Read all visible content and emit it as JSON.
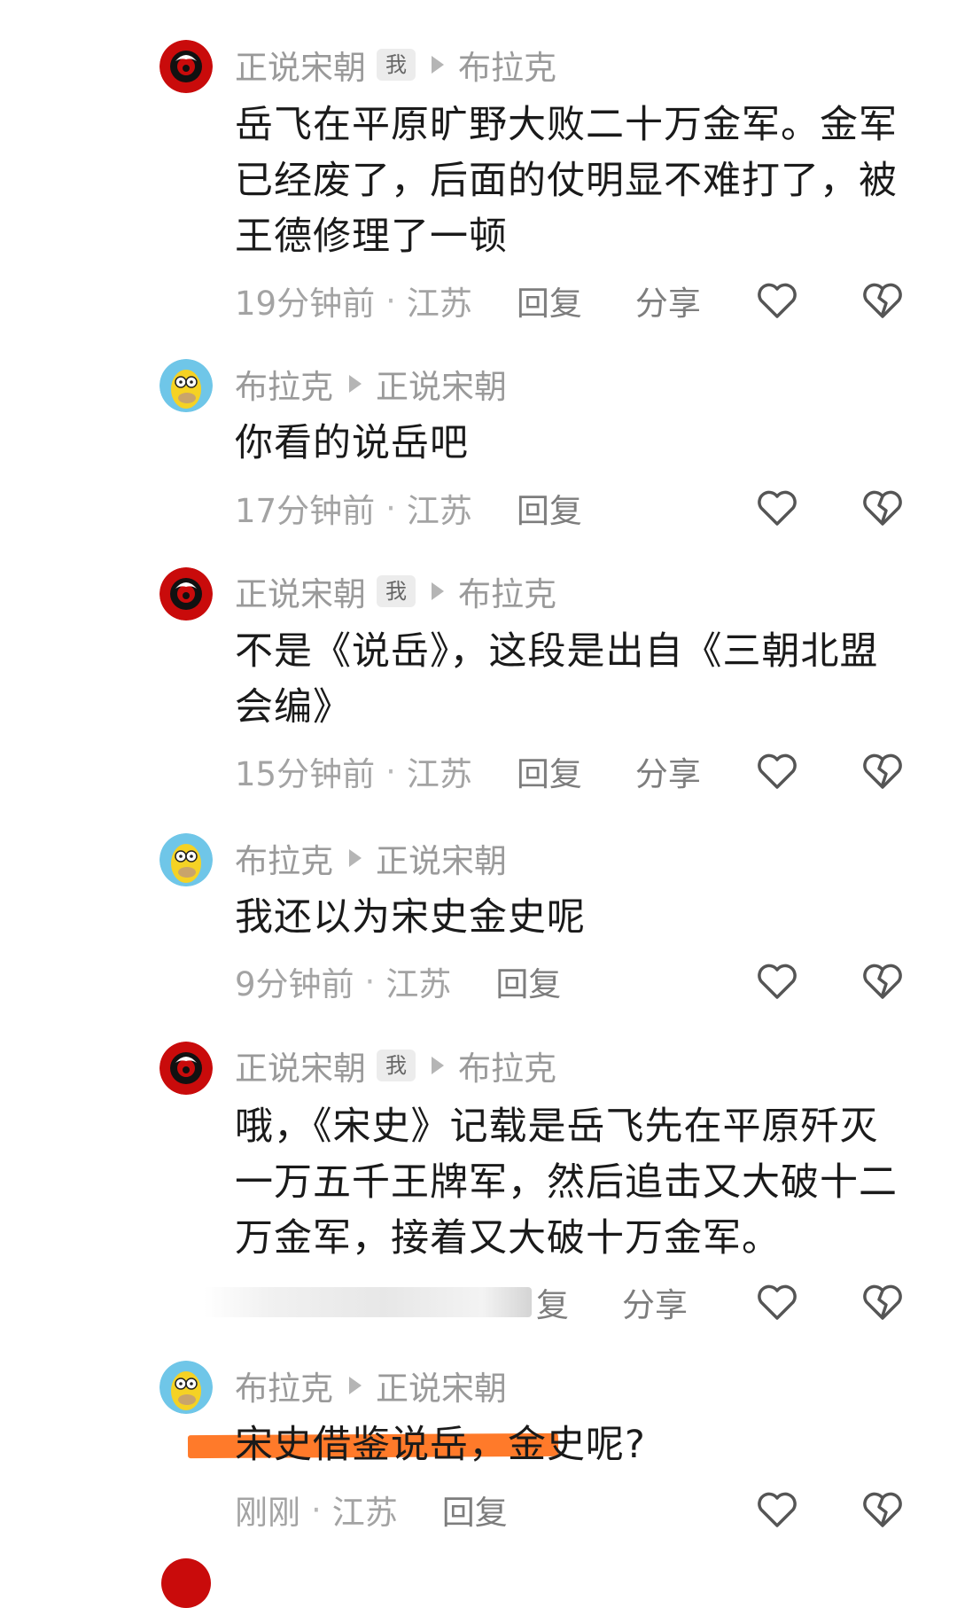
{
  "comments": [
    {
      "author": "正说宋朝",
      "me_badge": "我",
      "reply_to": "布拉克",
      "text": "岳飞在平原旷野大败二十万金军。金军已经废了，后面的仗明显不难打了，被王德修理了一顿",
      "time": "19分钟前",
      "location": "江苏",
      "reply": "回复",
      "share": "分享"
    },
    {
      "author": "布拉克",
      "reply_to": "正说宋朝",
      "text": "你看的说岳吧",
      "time": "17分钟前",
      "location": "江苏",
      "reply": "回复"
    },
    {
      "author": "正说宋朝",
      "me_badge": "我",
      "reply_to": "布拉克",
      "text": "不是《说岳》，这段是出自《三朝北盟会编》",
      "time": "15分钟前",
      "location": "江苏",
      "reply": "回复",
      "share": "分享"
    },
    {
      "author": "布拉克",
      "reply_to": "正说宋朝",
      "text": "我还以为宋史金史呢",
      "time": "9分钟前",
      "location": "江苏",
      "reply": "回复"
    },
    {
      "author": "正说宋朝",
      "me_badge": "我",
      "reply_to": "布拉克",
      "text": "哦，《宋史》记载是岳飞先在平原歼灭一万五千王牌军，然后追击又大破十二万金军，接着又大破十万金军。",
      "reply_partial": "复",
      "share": "分享"
    },
    {
      "author": "布拉克",
      "reply_to": "正说宋朝",
      "text": "宋史借鉴说岳，金史呢?",
      "time": "刚刚",
      "location": "江苏",
      "reply": "回复"
    }
  ],
  "icons": {
    "like": "heart-outline-icon",
    "dislike": "broken-heart-icon"
  },
  "colors": {
    "meta": "#9a9a9a",
    "body": "#1a1a1a",
    "highlight": "#ff7a2a",
    "avatar_red": "#c90b0b",
    "avatar_yellow": "#f5d224"
  }
}
